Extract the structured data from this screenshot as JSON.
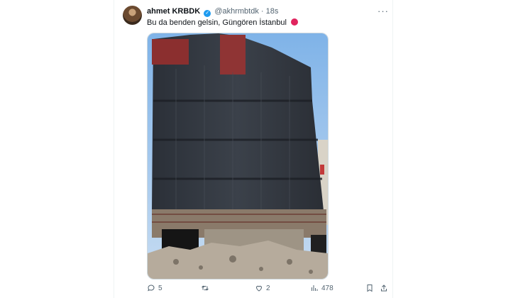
{
  "author": {
    "display_name": "ahmet KRBDK",
    "handle": "@akhrmbtdk",
    "separator": "·",
    "time": "18s"
  },
  "tweet_text": "Bu da benden gelsin, Güngören İstanbul",
  "icons": {
    "verified": "verified-badge-icon",
    "more": "more-horizontal-icon",
    "reply": "reply-icon",
    "retweet": "retweet-icon",
    "like": "like-heart-icon",
    "views": "views-bar-chart-icon",
    "bookmark": "bookmark-icon",
    "share": "share-icon"
  },
  "actions": {
    "replies": "5",
    "retweets": "",
    "likes": "2",
    "views": "478"
  },
  "colors": {
    "accent": "#1d9bf0",
    "text_primary": "#0f1419",
    "text_secondary": "#536471",
    "emoji_red": "#e0245e"
  }
}
